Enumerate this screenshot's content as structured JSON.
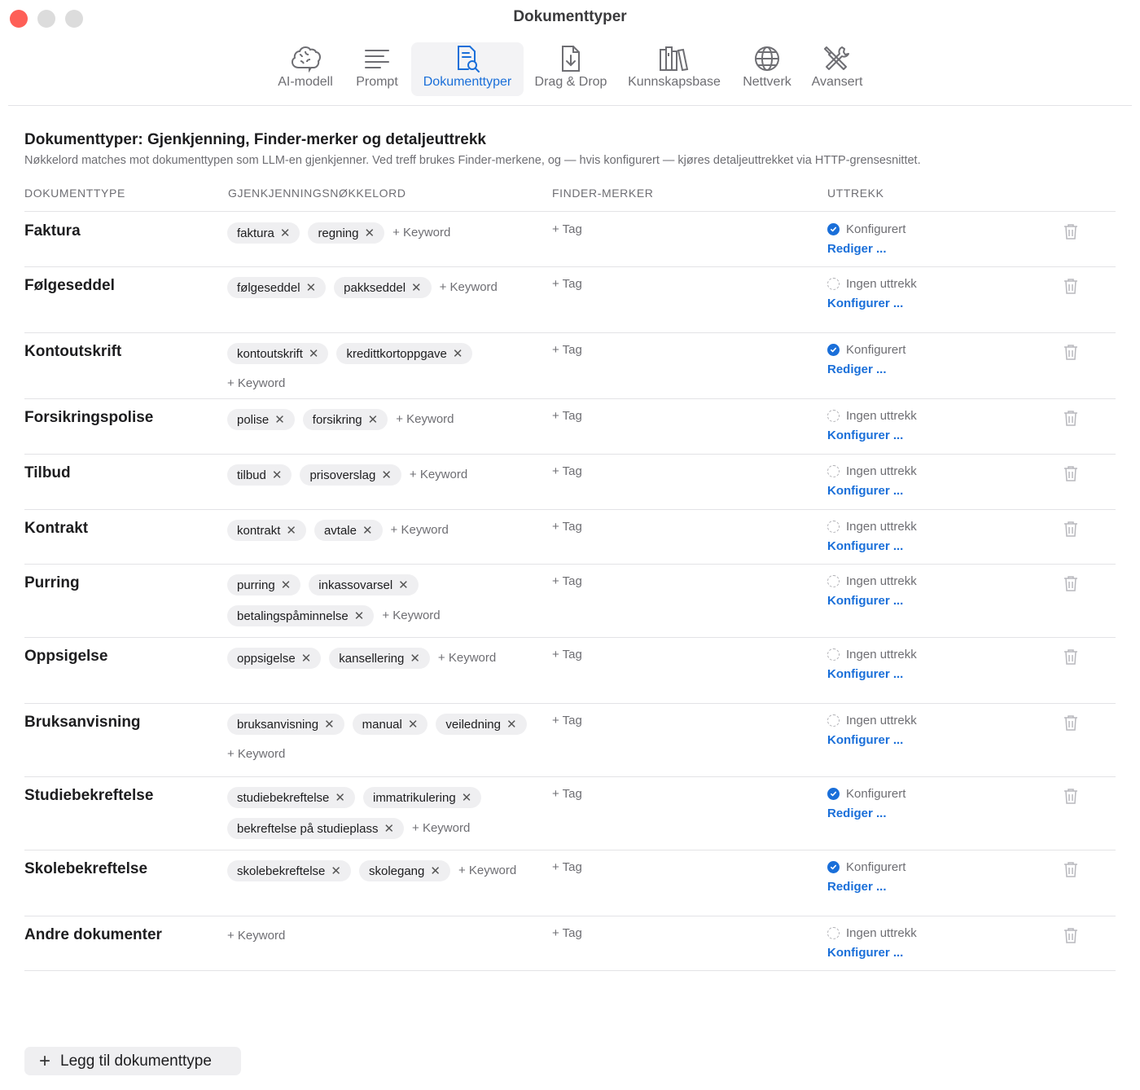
{
  "window": {
    "title": "Dokumenttyper"
  },
  "toolbar": {
    "items": [
      {
        "label": "AI-modell",
        "icon": "brain-icon"
      },
      {
        "label": "Prompt",
        "icon": "text-lines-icon"
      },
      {
        "label": "Dokumenttyper",
        "icon": "document-search-icon",
        "active": true
      },
      {
        "label": "Drag & Drop",
        "icon": "document-download-icon"
      },
      {
        "label": "Kunnskapsbase",
        "icon": "books-icon"
      },
      {
        "label": "Nettverk",
        "icon": "globe-icon"
      },
      {
        "label": "Avansert",
        "icon": "tools-icon"
      }
    ]
  },
  "section": {
    "title": "Dokumenttyper: Gjenkjenning, Finder-merker og detaljeuttrekk",
    "subtitle": "Nøkkelord matches mot dokumenttypen som LLM-en gjenkjenner. Ved treff brukes Finder-merkene, og — hvis konfigurert — kjøres detaljeuttrekket via HTTP-grensesnittet."
  },
  "table": {
    "headers": {
      "type": "DOKUMENTTYPE",
      "keywords": "GJENKJENNINGSNØKKELORD",
      "tags": "FINDER-MERKER",
      "extract": "UTTREKK"
    },
    "add_keyword_label": "+ Keyword",
    "add_tag_label": "+ Tag",
    "rows": [
      {
        "name": "Faktura",
        "keywords": [
          "faktura",
          "regning"
        ],
        "status": "Konfigurert",
        "configured": true,
        "action": "Rediger ..."
      },
      {
        "name": "Følgeseddel",
        "keywords": [
          "følgeseddel",
          "pakkseddel"
        ],
        "status": "Ingen uttrekk",
        "configured": false,
        "action": "Konfigurer ..."
      },
      {
        "name": "Kontoutskrift",
        "keywords": [
          "kontoutskrift",
          "kredittkortoppgave"
        ],
        "status": "Konfigurert",
        "configured": true,
        "action": "Rediger ..."
      },
      {
        "name": "Forsikringspolise",
        "keywords": [
          "polise",
          "forsikring"
        ],
        "status": "Ingen uttrekk",
        "configured": false,
        "action": "Konfigurer ..."
      },
      {
        "name": "Tilbud",
        "keywords": [
          "tilbud",
          "prisoverslag"
        ],
        "status": "Ingen uttrekk",
        "configured": false,
        "action": "Konfigurer ..."
      },
      {
        "name": "Kontrakt",
        "keywords": [
          "kontrakt",
          "avtale"
        ],
        "status": "Ingen uttrekk",
        "configured": false,
        "action": "Konfigurer ..."
      },
      {
        "name": "Purring",
        "keywords": [
          "purring",
          "inkassovarsel",
          "betalingspåminnelse"
        ],
        "status": "Ingen uttrekk",
        "configured": false,
        "action": "Konfigurer ..."
      },
      {
        "name": "Oppsigelse",
        "keywords": [
          "oppsigelse",
          "kansellering"
        ],
        "status": "Ingen uttrekk",
        "configured": false,
        "action": "Konfigurer ..."
      },
      {
        "name": "Bruksanvisning",
        "keywords": [
          "bruksanvisning",
          "manual",
          "veiledning"
        ],
        "status": "Ingen uttrekk",
        "configured": false,
        "action": "Konfigurer ..."
      },
      {
        "name": "Studiebekreftelse",
        "keywords": [
          "studiebekreftelse",
          "immatrikulering",
          "bekreftelse på studieplass"
        ],
        "status": "Konfigurert",
        "configured": true,
        "action": "Rediger ..."
      },
      {
        "name": "Skolebekreftelse",
        "keywords": [
          "skolebekreftelse",
          "skolegang"
        ],
        "status": "Konfigurert",
        "configured": true,
        "action": "Rediger ..."
      },
      {
        "name": "Andre dokumenter",
        "keywords": [],
        "status": "Ingen uttrekk",
        "configured": false,
        "action": "Konfigurer ..."
      }
    ]
  },
  "footer": {
    "add_button_label": "Legg til dokumenttype"
  },
  "colors": {
    "accent": "#1a6fd9",
    "close": "#fe5f57",
    "chip": "#efeff1"
  }
}
